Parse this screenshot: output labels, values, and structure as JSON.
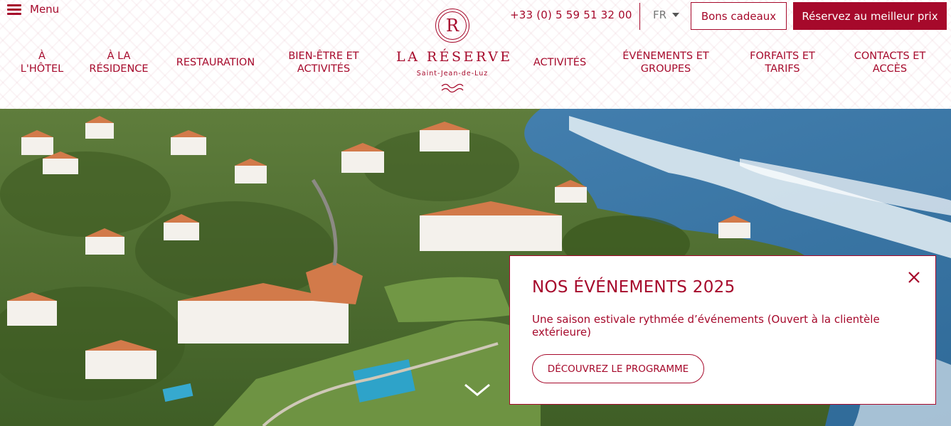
{
  "header": {
    "menu_label": "Menu",
    "phone": "+33 (0) 5 59 51 32 00",
    "language": "FR",
    "gift_button": "Bons cadeaux",
    "book_button": "Réservez au meilleur prix"
  },
  "logo": {
    "letter": "R",
    "name": "LA RÉSERVE",
    "subtitle": "Saint-Jean-de-Luz"
  },
  "nav": {
    "items": [
      {
        "label": "À L'HÔTEL"
      },
      {
        "label": "À LA RÉSIDENCE"
      },
      {
        "label": "RESTAURATION"
      },
      {
        "label": "BIEN-ÊTRE ET ACTIVITÉS"
      },
      {
        "label": "ACTIVITÉS"
      },
      {
        "label": "ÉVÉNEMENTS ET GROUPES"
      },
      {
        "label": "FORFAITS ET TARIFS"
      },
      {
        "label": "CONTACTS ET ACCÈS"
      }
    ]
  },
  "popup": {
    "title": "NOS ÉVÉNEMENTS 2025",
    "description": "Une saison estivale rythmée d’événements (Ouvert à la clientèle extérieure)",
    "cta": "DÉCOUVREZ LE PROGRAMME"
  },
  "icons": {
    "menu": "hamburger-icon",
    "language": "caret-down-icon",
    "close": "close-icon",
    "scroll": "chevron-down-icon"
  },
  "colors": {
    "brand": "#a6092b",
    "background": "#ffffff"
  }
}
